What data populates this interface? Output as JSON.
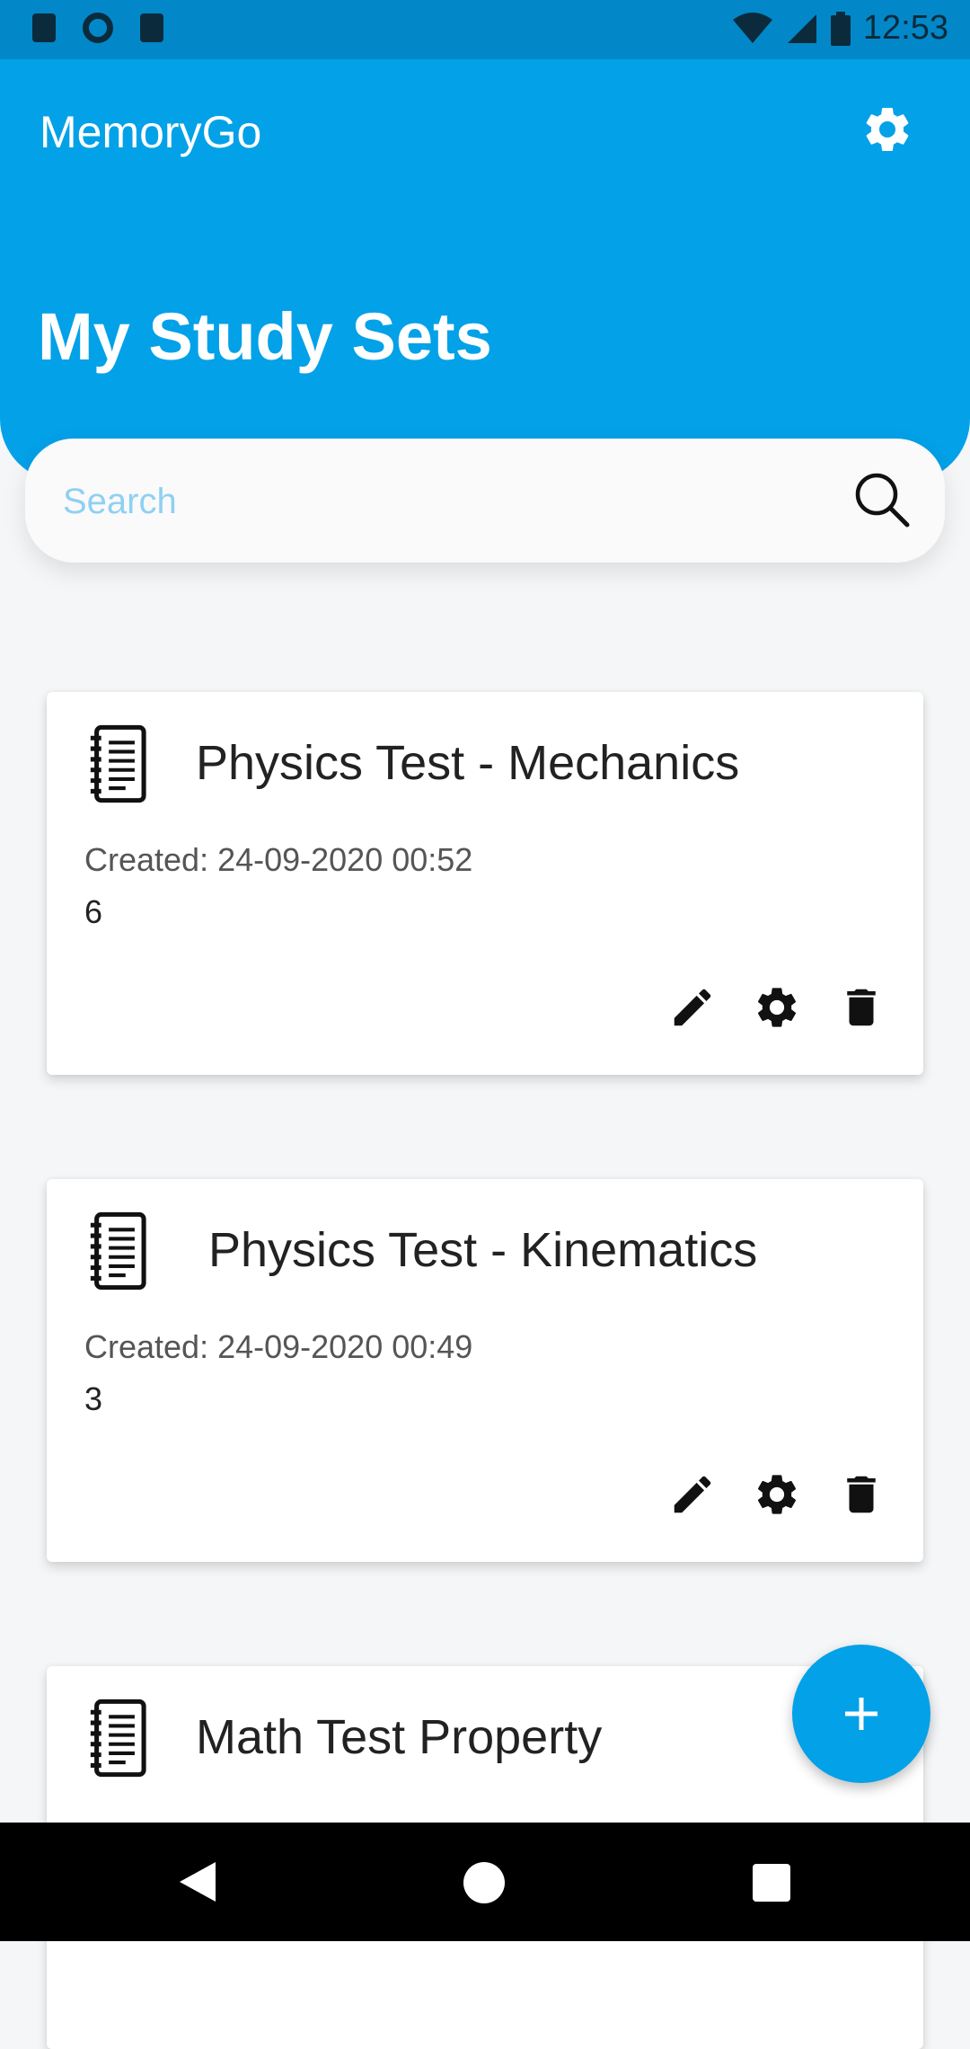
{
  "status_bar": {
    "time": "12:53",
    "icons": [
      "notification-icon",
      "sync-icon",
      "sd-card-icon",
      "wifi-icon",
      "signal-icon",
      "battery-icon"
    ]
  },
  "header": {
    "app_title": "MemoryGo",
    "page_title": "My Study Sets",
    "settings_icon": "gear-icon"
  },
  "search": {
    "placeholder": "Search",
    "value": "",
    "icon": "search-icon"
  },
  "cards": [
    {
      "title": "Physics Test - Mechanics",
      "created": "Created: 24-09-2020 00:52",
      "count": "6"
    },
    {
      "title": "Physics Test - Kinematics",
      "created": "Created: 24-09-2020 00:49",
      "count": "3"
    },
    {
      "title": "Math Test Property",
      "created": "",
      "count": ""
    }
  ],
  "card_actions": [
    "edit-icon",
    "gear-icon",
    "delete-icon"
  ],
  "fab": {
    "icon": "plus-icon"
  },
  "nav_bar": {
    "icons": [
      "back-icon",
      "home-icon",
      "recents-icon"
    ]
  },
  "colors": {
    "primary": "#03a1e8",
    "status_bar": "#0288c8",
    "background": "#f5f6f7",
    "placeholder": "#8fd0f2"
  }
}
